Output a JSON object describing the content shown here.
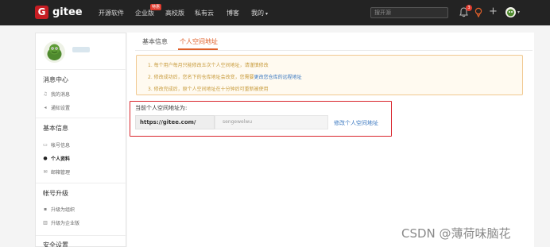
{
  "nav": {
    "brand": "gitee",
    "logo_mark": "G",
    "items": [
      "开源软件",
      "企业版",
      "高校版",
      "私有云",
      "博客",
      "我的"
    ],
    "hot_badge": "特惠",
    "search_placeholder": "搜开源",
    "notification_count": "3"
  },
  "sidebar": {
    "sections": [
      {
        "title": "消息中心",
        "items": [
          "我的消息",
          "通知设置"
        ]
      },
      {
        "title": "基本信息",
        "items": [
          "帐号信息",
          "个人资料",
          "邮箱管理"
        ]
      },
      {
        "title": "帐号升级",
        "items": [
          "升级为组织",
          "升级为企业版"
        ]
      },
      {
        "title": "安全设置",
        "items": []
      }
    ]
  },
  "main": {
    "tabs": [
      "基本信息",
      "个人空间地址"
    ],
    "active_tab": "个人空间地址",
    "notice": {
      "line1": "1. 每个用户每月只能修改五次个人空间地址，请谨慎修改",
      "line2_text": "2. 修改成功后，您名下的仓库地址会改变，您需要",
      "line2_link": "更改您仓库的远程地址",
      "line3": "3. 修改完成后，原个人空间地址在十分钟后可重新被使用"
    },
    "address": {
      "label": "当前个人空间地址为:",
      "prefix": "https://gitee.com/",
      "value": "sengewelwu",
      "edit_link": "修改个人空间地址"
    }
  },
  "watermark": "CSDN @薄荷味脑花",
  "colors": {
    "nav_bg": "#232323",
    "brand_red": "#c71d23",
    "accent_orange": "#e0602a",
    "link_blue": "#3a78c0",
    "highlight_red": "#d9242b"
  }
}
